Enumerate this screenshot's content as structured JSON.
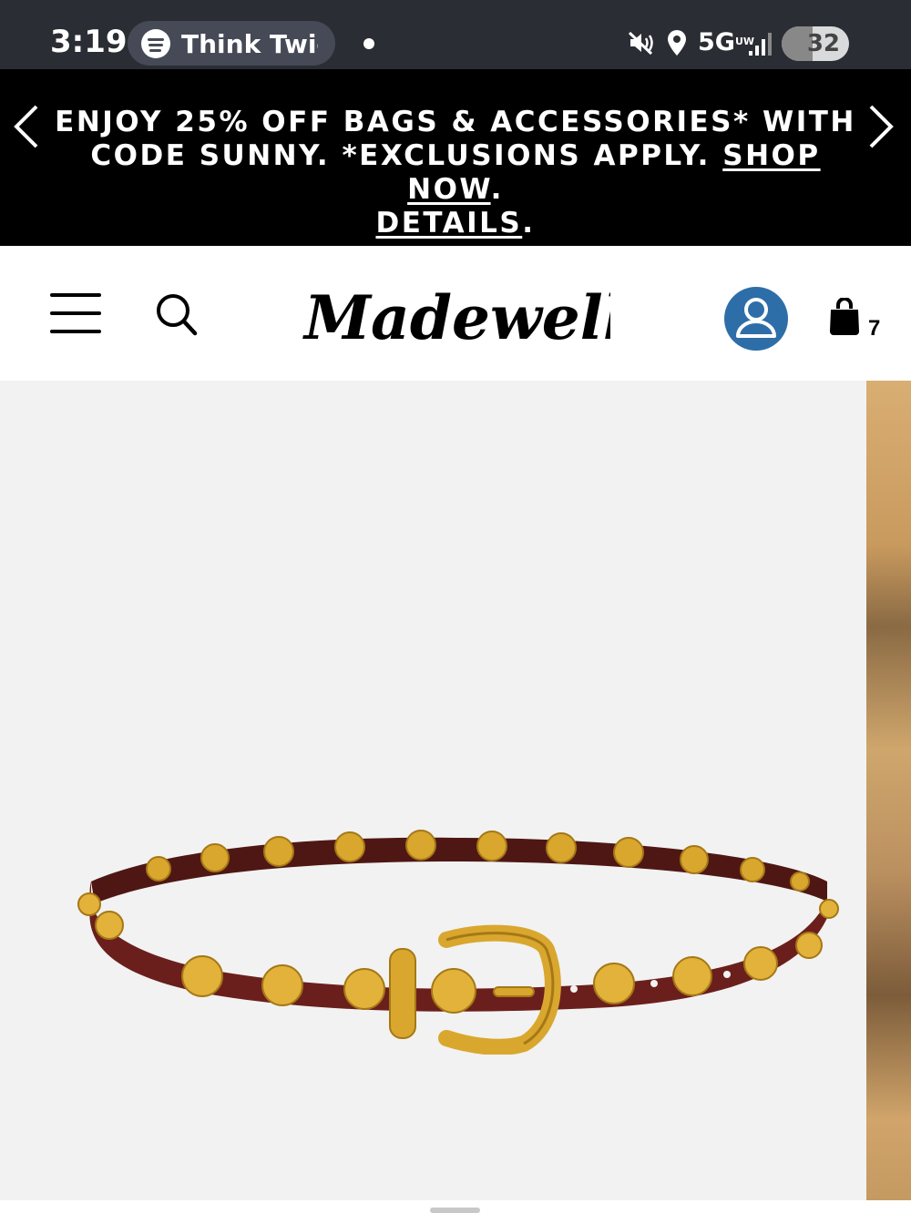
{
  "status_bar": {
    "time": "3:19",
    "media_app_icon": "spotify-icon",
    "media_title": "Think Twice",
    "network": "5G",
    "network_sub": "UW",
    "battery": "32"
  },
  "promo": {
    "line_main": "ENJOY 25% OFF BAGS & ACCESSORIES* WITH CODE SUNNY. *EXCLUSIONS APPLY. ",
    "shop_now": "SHOP NOW",
    "details": "DETAILS",
    "period": "."
  },
  "header": {
    "brand": "Madewell",
    "cart_count": "7"
  },
  "product": {
    "image_description": "studded leather belt",
    "colors": {
      "leather": "#6b1f1c",
      "brass": "#d9a72e",
      "background": "#f2f2f2"
    }
  },
  "icons": [
    "chevron-left-icon",
    "chevron-right-icon",
    "menu-icon",
    "search-icon",
    "account-icon",
    "bag-icon"
  ]
}
